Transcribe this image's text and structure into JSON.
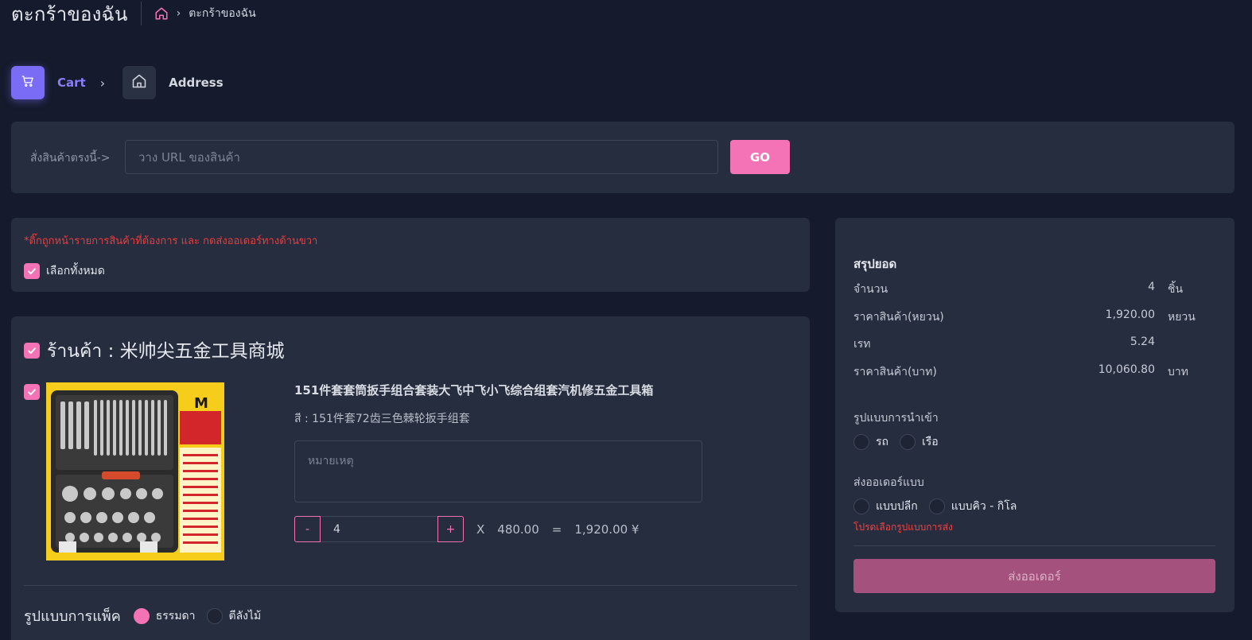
{
  "header": {
    "title": "ตะกร้าของฉัน",
    "breadcrumb_current": "ตะกร้าของฉัน"
  },
  "stepper": {
    "steps": [
      {
        "label": "Cart",
        "icon": "cart-icon",
        "active": true
      },
      {
        "label": "Address",
        "icon": "home-icon",
        "active": false
      }
    ]
  },
  "url_order": {
    "label": "สั่งสินค้าตรงนี้->",
    "placeholder": "วาง URL ของสินค้า",
    "go_label": "GO"
  },
  "selection": {
    "warning": "*ติ๊กถูกหน้ารายการสินค้าที่ต้องการ และ กดส่งออเดอร์ทางด้านขวา",
    "select_all_label": "เลือกทั้งหมด",
    "select_all_checked": true
  },
  "store": {
    "name": "ร้านค้า : 米帅尖五金工具商城",
    "checked": true,
    "item": {
      "checked": true,
      "title": "151件套套筒扳手组合套装大飞中飞小飞综合组套汽机修五金工具箱",
      "variant": "สี : 151件套72齿三色棘轮扳手组套",
      "note_placeholder": "หมายเหตุ",
      "minus_label": "-",
      "plus_label": "+",
      "quantity": "4",
      "times_label": "X",
      "unit_price": "480.00",
      "equals_label": "=",
      "total": "1,920.00 ¥"
    },
    "packing": {
      "label": "รูปแบบการแพ็ค",
      "options": [
        {
          "label": "ธรรมดา",
          "selected": true
        },
        {
          "label": "ตีลังไม้",
          "selected": false
        }
      ]
    }
  },
  "summary": {
    "title": "สรุปยอด",
    "rows": [
      {
        "label": "จำนวน",
        "value": "4",
        "unit": "ชิ้น"
      },
      {
        "label": "ราคาสินค้า(หยวน)",
        "value": "1,920.00",
        "unit": "หยวน"
      },
      {
        "label": "เรท",
        "value": "5.24",
        "unit": ""
      },
      {
        "label": "ราคาสินค้า(บาท)",
        "value": "10,060.80",
        "unit": "บาท"
      }
    ],
    "import_label": "รูปแบบการนำเข้า",
    "import_options": [
      "รถ",
      "เรือ"
    ],
    "shipping_label": "ส่งออเดอร์แบบ",
    "shipping_options": [
      "แบบปลีก",
      "แบบคิว - กิโล"
    ],
    "shipping_warning": "โปรดเลือกรูปแบบการส่ง",
    "order_button": "ส่งออเดอร์"
  },
  "colors": {
    "background": "#151b2d",
    "card": "#262d3f",
    "accent_pink": "#f472b6",
    "accent_purple": "#7b6cf6",
    "warning_red": "#ee3b3b"
  }
}
